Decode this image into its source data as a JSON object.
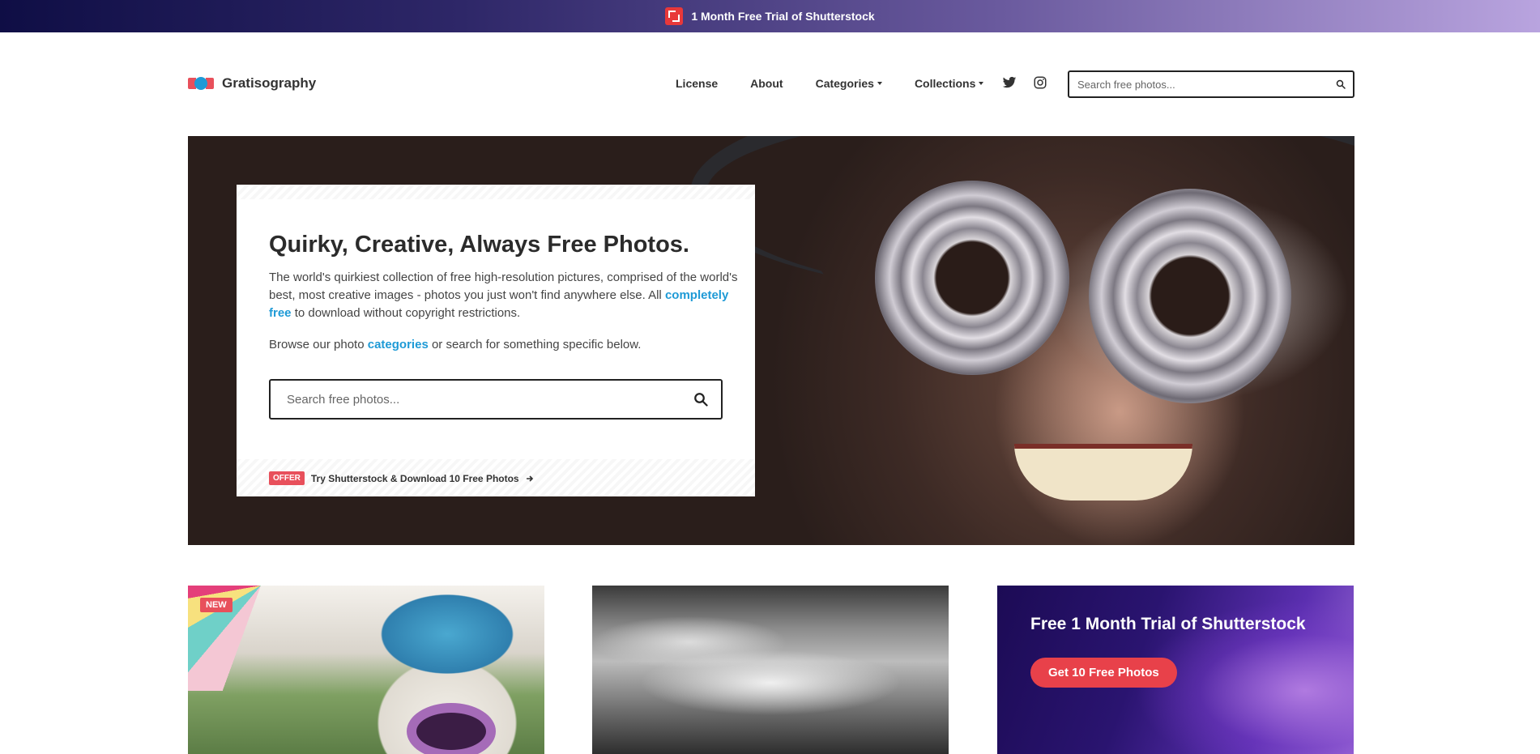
{
  "promo": {
    "text": "1 Month Free Trial of Shutterstock"
  },
  "brand": {
    "name": "Gratisography"
  },
  "nav": {
    "license": "License",
    "about": "About",
    "categories": "Categories",
    "collections": "Collections"
  },
  "header_search": {
    "placeholder": "Search free photos..."
  },
  "hero": {
    "title": "Quirky, Creative, Always Free Photos.",
    "desc_1": "The world's quirkiest collection of free high-resolution pictures, comprised of the world's best, most creative images - photos you just won't find anywhere else. All ",
    "desc_link": "completely free",
    "desc_2": " to download without copyright restrictions.",
    "browse_1": "Browse our photo ",
    "browse_link": "categories",
    "browse_2": " or search for something specific below.",
    "search_placeholder": "Search free photos...",
    "offer_badge": "OFFER",
    "offer_text": "Try Shutterstock & Download 10 Free Photos"
  },
  "cards": {
    "card1_badge": "NEW",
    "card3_title": "Free 1 Month Trial of Shutterstock",
    "card3_button": "Get 10 Free Photos"
  },
  "colors": {
    "accent_blue": "#1e9ad6",
    "accent_red": "#e8505b",
    "button_red": "#e8414a"
  }
}
